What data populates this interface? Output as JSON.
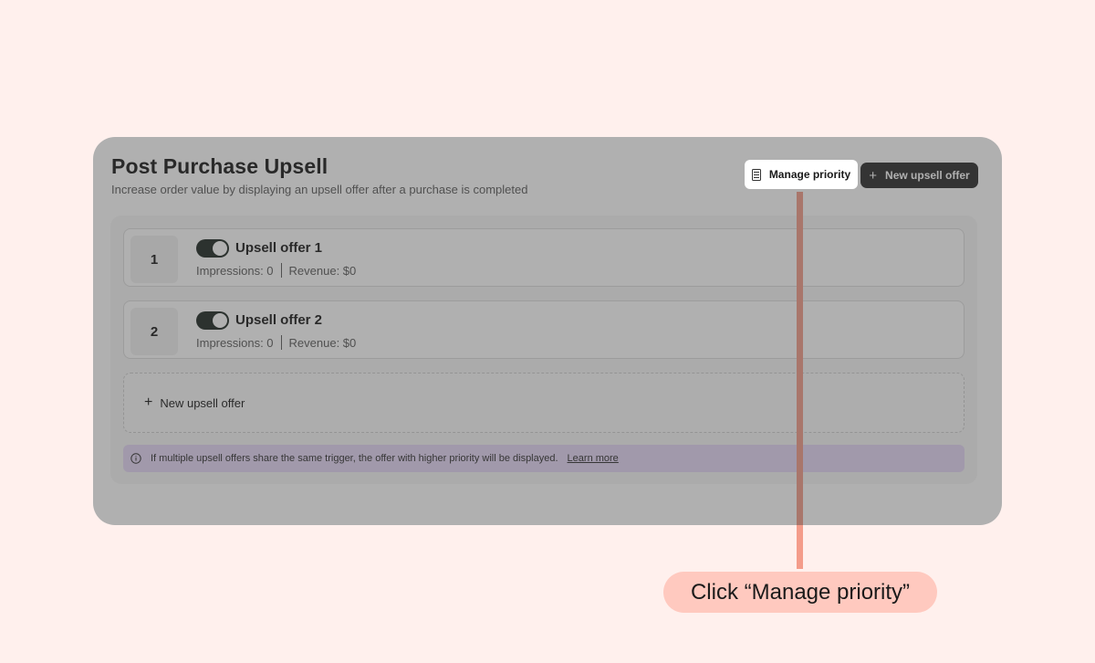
{
  "header": {
    "title": "Post Purchase Upsell",
    "subtitle": "Increase order value by displaying an upsell offer after a purchase is completed",
    "manage_priority_label": "Manage priority",
    "new_offer_label": "New upsell offer",
    "plus_glyph": "+"
  },
  "offers": [
    {
      "priority": "1",
      "name": "Upsell offer 1",
      "enabled": true,
      "impressions": "Impressions: 0",
      "revenue": "Revenue: $0"
    },
    {
      "priority": "2",
      "name": "Upsell offer 2",
      "enabled": true,
      "impressions": "Impressions: 0",
      "revenue": "Revenue: $0"
    }
  ],
  "add_offer": {
    "label": "New upsell offer",
    "plus_glyph": "+"
  },
  "banner": {
    "text": "If multiple upsell offers share the same trigger, the offer with higher priority will be displayed.",
    "link": "Learn more"
  },
  "callout": {
    "text": "Click “Manage priority”"
  },
  "icons": {
    "manage": "list-icon",
    "plus": "plus-icon",
    "info": "info-icon"
  },
  "colors": {
    "background": "#fff0ed",
    "primary_button": "#2d2d2d",
    "toggle_on": "#1f2a24",
    "banner": "#e6d8f7",
    "callout": "#ffc9bf",
    "pointer": "#f49c8a"
  }
}
